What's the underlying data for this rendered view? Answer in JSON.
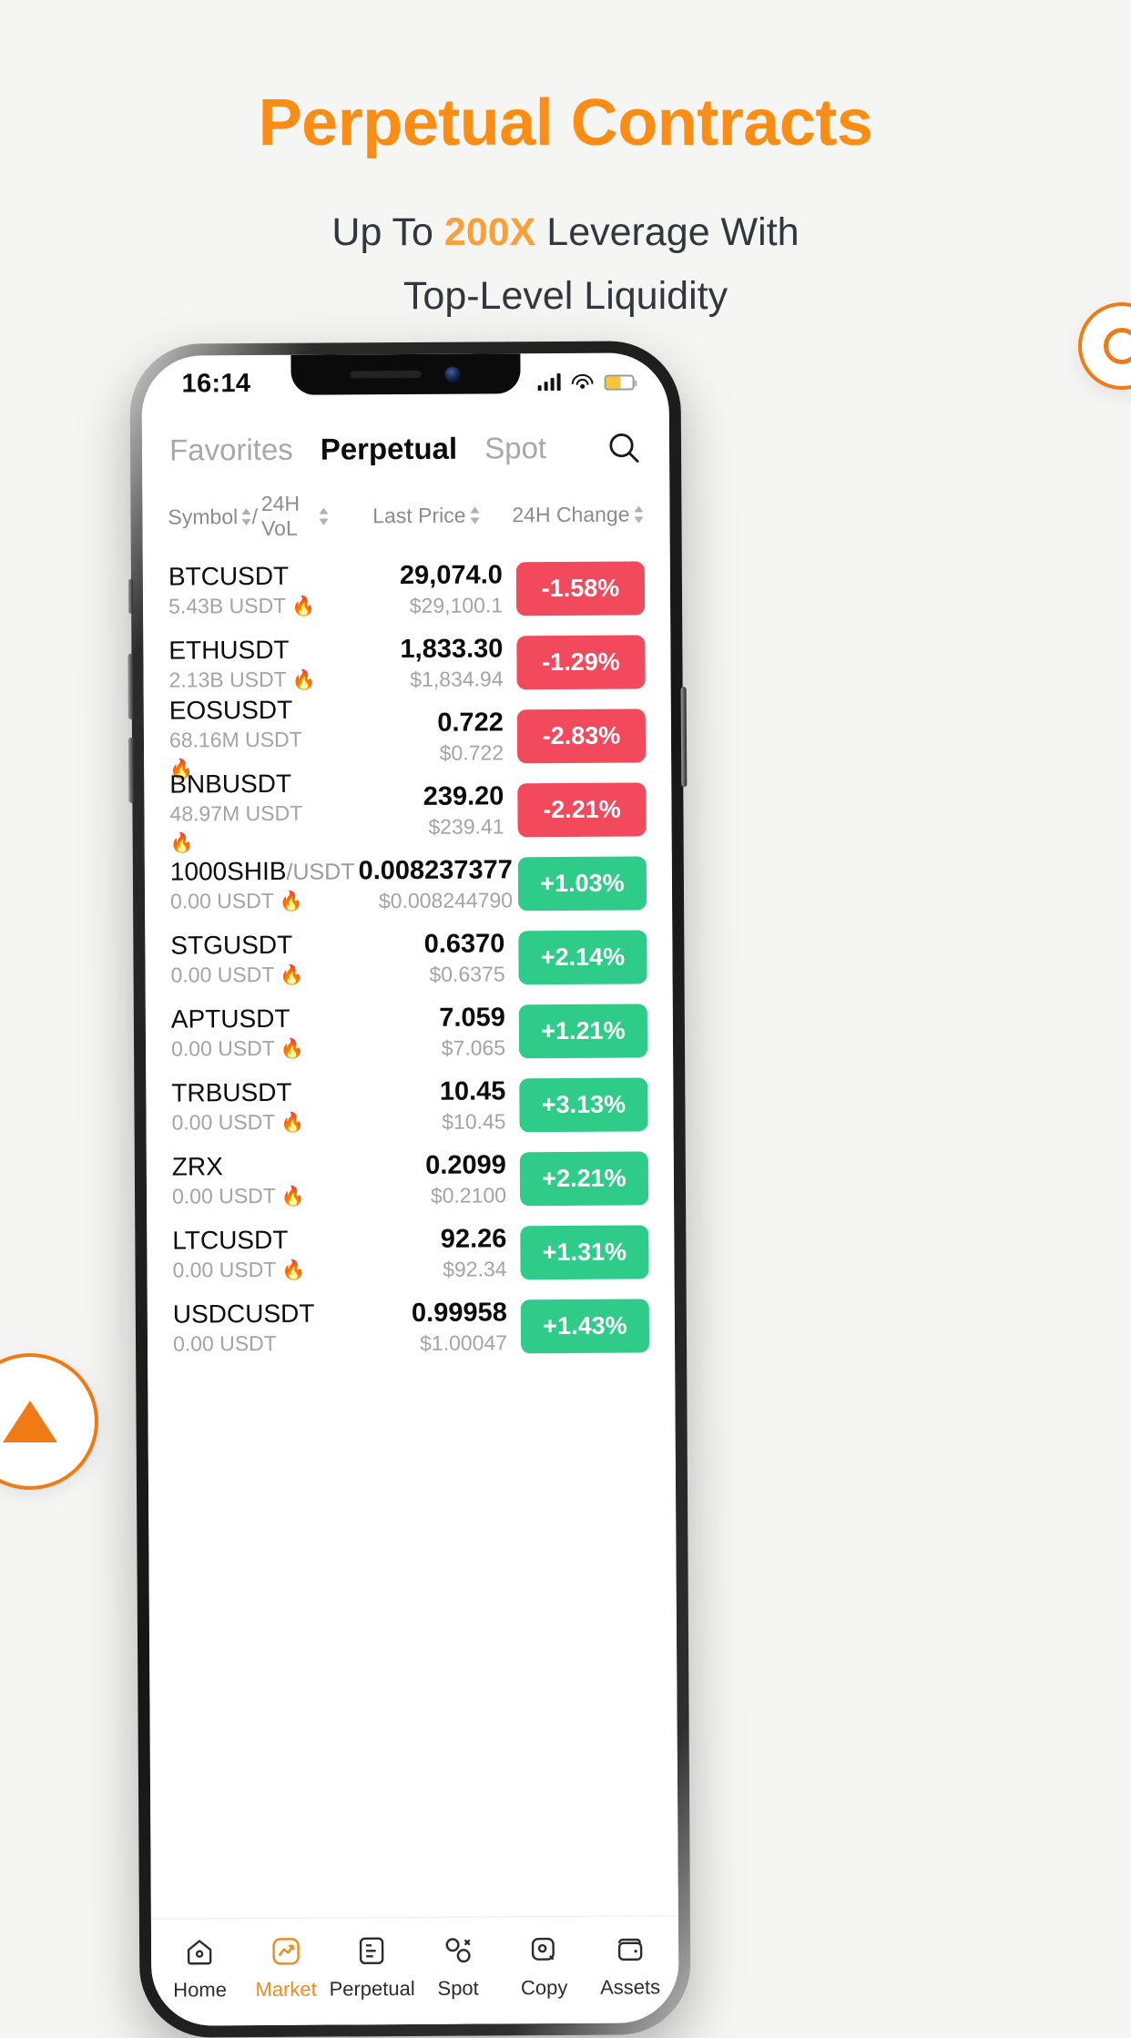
{
  "hero": {
    "title": "Perpetual Contracts",
    "sub_pre": "Up To ",
    "sub_highlight": "200X",
    "sub_mid": " Leverage With",
    "sub_line2": "Top-Level Liquidity",
    "title_color": "#fb8c14",
    "highlight_color": "#f9a03c"
  },
  "status": {
    "time": "16:14",
    "signal_icon": "cellular-signal-icon",
    "wifi_icon": "wifi-icon",
    "battery_icon": "battery-icon",
    "battery_level": "55%"
  },
  "tabs": [
    {
      "label": "Favorites",
      "active": false
    },
    {
      "label": "Perpetual",
      "active": true
    },
    {
      "label": "Spot",
      "active": false
    }
  ],
  "search": {
    "icon": "search-icon"
  },
  "table": {
    "headers": {
      "symbol": "Symbol",
      "separator": "/",
      "volume": "24H VoL",
      "price": "Last Price",
      "change": "24H Change"
    },
    "rows": [
      {
        "symbol": "BTCUSDT",
        "suffix": "",
        "volume": "5.43B USDT",
        "hot": "🔥",
        "price": "29,074.0",
        "usd": "$29,100.1",
        "change": "-1.58%",
        "dir": "down"
      },
      {
        "symbol": "ETHUSDT",
        "suffix": "",
        "volume": "2.13B USDT",
        "hot": "🔥",
        "price": "1,833.30",
        "usd": "$1,834.94",
        "change": "-1.29%",
        "dir": "down"
      },
      {
        "symbol": "EOSUSDT",
        "suffix": "",
        "volume": "68.16M USDT",
        "hot": "🔥",
        "price": "0.722",
        "usd": "$0.722",
        "change": "-2.83%",
        "dir": "down"
      },
      {
        "symbol": "BNBUSDT",
        "suffix": "",
        "volume": "48.97M USDT",
        "hot": "🔥",
        "price": "239.20",
        "usd": "$239.41",
        "change": "-2.21%",
        "dir": "down"
      },
      {
        "symbol": "1000SHIB",
        "suffix": "/USDT",
        "volume": "0.00 USDT",
        "hot": "🔥",
        "price": "0.008237377",
        "usd": "$0.008244790",
        "change": "+1.03%",
        "dir": "up"
      },
      {
        "symbol": "STGUSDT",
        "suffix": "",
        "volume": "0.00 USDT",
        "hot": "🔥",
        "price": "0.6370",
        "usd": "$0.6375",
        "change": "+2.14%",
        "dir": "up"
      },
      {
        "symbol": "APTUSDT",
        "suffix": "",
        "volume": "0.00 USDT",
        "hot": "🔥",
        "price": "7.059",
        "usd": "$7.065",
        "change": "+1.21%",
        "dir": "up"
      },
      {
        "symbol": "TRBUSDT",
        "suffix": "",
        "volume": "0.00 USDT",
        "hot": "🔥",
        "price": "10.45",
        "usd": "$10.45",
        "change": "+3.13%",
        "dir": "up"
      },
      {
        "symbol": "ZRX",
        "suffix": "",
        "volume": "0.00 USDT",
        "hot": "🔥",
        "price": "0.2099",
        "usd": "$0.2100",
        "change": "+2.21%",
        "dir": "up"
      },
      {
        "symbol": "LTCUSDT",
        "suffix": "",
        "volume": "0.00 USDT",
        "hot": "🔥",
        "price": "92.26",
        "usd": "$92.34",
        "change": "+1.31%",
        "dir": "up"
      },
      {
        "symbol": "USDCUSDT",
        "suffix": "",
        "volume": "0.00 USDT",
        "hot": "",
        "price": "0.99958",
        "usd": "$1.00047",
        "change": "+1.43%",
        "dir": "up"
      }
    ]
  },
  "bottom_nav": [
    {
      "label": "Home",
      "icon": "home-icon",
      "active": false
    },
    {
      "label": "Market",
      "icon": "chart-icon",
      "active": true
    },
    {
      "label": "Perpetual",
      "icon": "contract-icon",
      "active": false
    },
    {
      "label": "Spot",
      "icon": "spot-icon",
      "active": false
    },
    {
      "label": "Copy",
      "icon": "copy-icon",
      "active": false
    },
    {
      "label": "Assets",
      "icon": "wallet-icon",
      "active": false
    }
  ],
  "colors": {
    "up": "#2ecc88",
    "down": "#f2495c",
    "brand": "#f08a1d",
    "page_bg": "#f5f5f4"
  }
}
